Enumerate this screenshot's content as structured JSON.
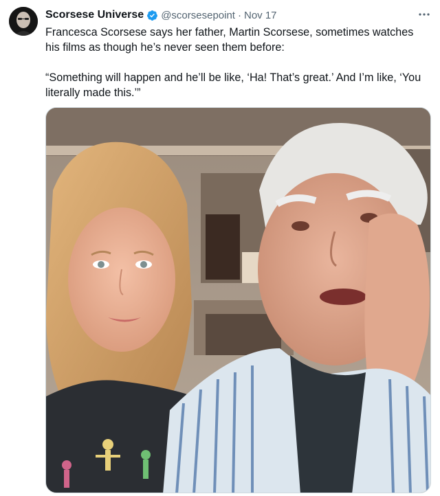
{
  "author": {
    "name": "Scorsese Universe",
    "handle": "@scorsesepoint",
    "separator": "·",
    "date": "Nov 17",
    "verified": true
  },
  "tweet": {
    "line1": "Francesca Scorsese says her father, Martin Scorsese, sometimes watches his films as though he’s never seen them before:",
    "line2": "“Something will happen and he’ll be like, ‘Ha! That’s great.’ And I’m like, ‘You literally made this.’”"
  },
  "icons": {
    "avatar": "avatar-photo",
    "verified": "verified-badge-icon",
    "more": "more-options-icon"
  },
  "colors": {
    "text": "#0f1419",
    "secondary": "#536471",
    "verified_blue": "#1d9bf0",
    "border": "#cfd9de"
  }
}
